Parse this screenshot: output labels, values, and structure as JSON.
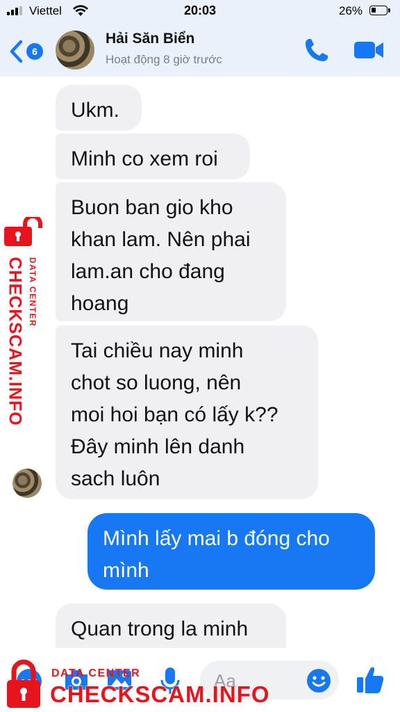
{
  "status_bar": {
    "carrier": "Viettel",
    "time": "20:03",
    "battery_percent": "26%",
    "signal_bars": 3,
    "battery_level": 0.26
  },
  "header": {
    "unread_count": "6",
    "contact_name": "Hải Săn Biển",
    "contact_status": "Hoạt động 8 giờ trước",
    "icons": [
      "back-chevron-icon",
      "phone-icon",
      "video-camera-icon"
    ]
  },
  "messages": [
    {
      "direction": "in",
      "lines": [
        "Ukm."
      ]
    },
    {
      "direction": "in",
      "lines": [
        "Minh co xem roi"
      ]
    },
    {
      "direction": "in",
      "lines": [
        "Buon ban gio kho",
        "khan lam. Nên phai",
        "lam.an cho đang",
        "hoang"
      ]
    },
    {
      "direction": "in",
      "lines": [
        "Tai chiều nay minh",
        "chot so luong, nên",
        "moi hoi bạn có lấy k??",
        "Đây minh lên danh",
        "sach luôn"
      ]
    },
    {
      "direction": "out",
      "lines": [
        "Mình lấy mai b đóng cho",
        "mình"
      ]
    },
    {
      "direction": "in",
      "lines": [
        "Quan trong la minh"
      ]
    }
  ],
  "composer": {
    "placeholder": "Aa",
    "icons": [
      "more-dots-icon",
      "camera-icon",
      "gallery-icon",
      "microphone-icon",
      "emoji-icon",
      "thumbs-up-icon"
    ]
  },
  "watermark": {
    "brand": "CHECKSCAM.INFO",
    "subtitle": "DATA CENTER"
  },
  "colors": {
    "accent": "#1678f2",
    "incoming_bubble": "#f0f0f2",
    "header_bg": "#e9f1fb",
    "watermark_red": "#e8141c"
  }
}
